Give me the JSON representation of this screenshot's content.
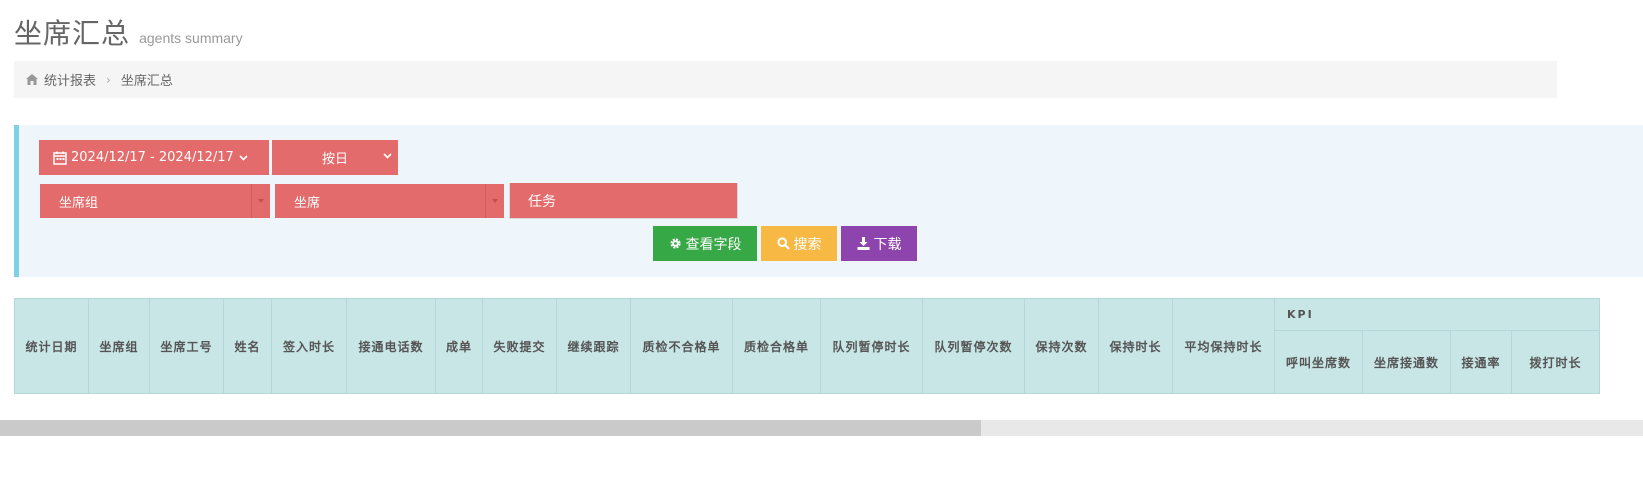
{
  "page": {
    "title": "坐席汇总",
    "subtitle": "agents summary"
  },
  "breadcrumb": {
    "items": [
      "统计报表",
      "坐席汇总"
    ]
  },
  "filters": {
    "date_range": "2024/12/17 - 2024/12/17",
    "period": "按日",
    "agent_group": "坐席组",
    "agent": "坐席",
    "task": "任务"
  },
  "buttons": {
    "view_fields": "查看字段",
    "search": "搜索",
    "download": "下载"
  },
  "table": {
    "columns": [
      "统计日期",
      "坐席组",
      "坐席工号",
      "姓名",
      "签入时长",
      "接通电话数",
      "成单",
      "失败提交",
      "继续跟踪",
      "质检不合格单",
      "质检合格单",
      "队列暂停时长",
      "队列暂停次数",
      "保持次数",
      "保持时长",
      "平均保持时长"
    ],
    "group_header": "KPI",
    "kpi_columns": [
      "呼叫坐席数",
      "坐席接通数",
      "接通率",
      "拨打时长"
    ]
  },
  "colors": {
    "filter_control": "#e46b6b",
    "view_fields_button": "#37a846",
    "search_button": "#f7b944",
    "download_button": "#8e44ad",
    "table_header": "#c9e6e7",
    "panel_accent": "#7fd0e4"
  },
  "icons": {
    "breadcrumb_home": "home-icon",
    "date": "calendar-icon",
    "view_fields": "gear-icon",
    "search": "search-icon",
    "download": "download-icon"
  }
}
